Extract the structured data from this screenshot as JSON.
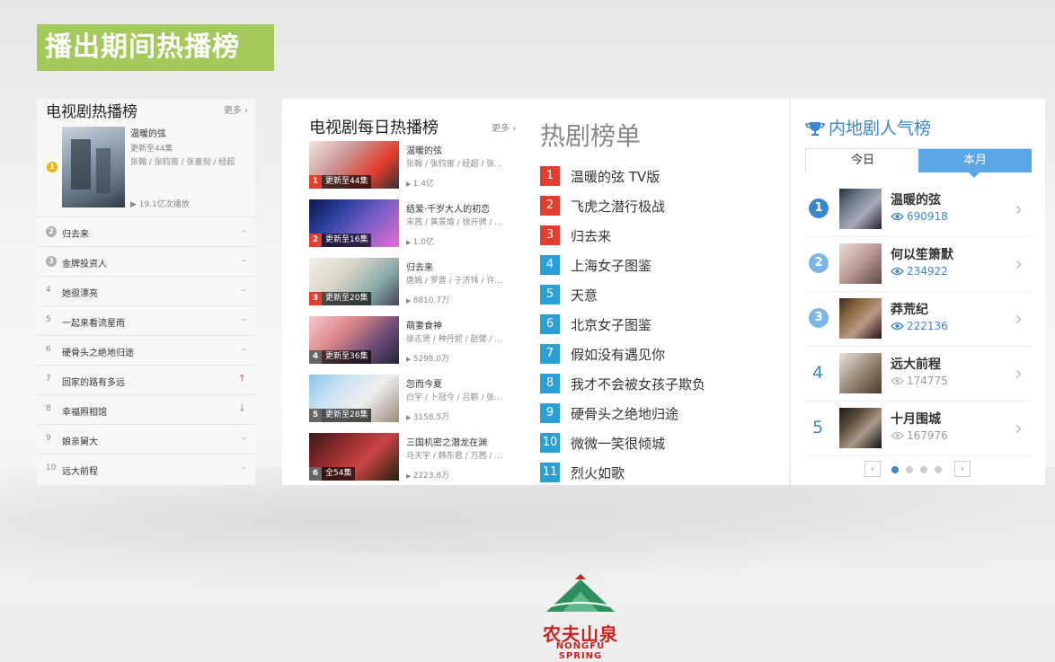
{
  "banner": {
    "title": "播出期间热播榜"
  },
  "tv_hot": {
    "heading": "电视剧热播榜",
    "more": "更多",
    "featured": {
      "rank": "1",
      "title": "温暖的弦",
      "update": "更新至44集",
      "cast": "张翰 / 张钧甯 / 张嘉倪 / 经超",
      "views": "19.1亿次播放"
    },
    "rows": [
      {
        "rank": "2",
        "name": "归去来",
        "trend": "–"
      },
      {
        "rank": "3",
        "name": "金牌投资人",
        "trend": "–"
      },
      {
        "rank": "4",
        "name": "她很漂亮",
        "trend": "–"
      },
      {
        "rank": "5",
        "name": "一起来看流星雨",
        "trend": "–"
      },
      {
        "rank": "6",
        "name": "硬骨头之绝地归途",
        "trend": "–"
      },
      {
        "rank": "7",
        "name": "回家的路有多远",
        "trend": "↑"
      },
      {
        "rank": "8",
        "name": "幸福照相馆",
        "trend": "↓"
      },
      {
        "rank": "9",
        "name": "娘亲舅大",
        "trend": "–"
      },
      {
        "rank": "10",
        "name": "远大前程",
        "trend": "–"
      }
    ]
  },
  "daily": {
    "heading": "电视剧每日热播榜",
    "more": "更多",
    "items": [
      {
        "rank": "1",
        "tag": "更新至44集",
        "title": "温暖的弦",
        "cast": "张翰 / 张钧甯 / 经超 / 张...",
        "views": "1.4亿"
      },
      {
        "rank": "2",
        "tag": "更新至16集",
        "title": "结爱·千岁大人的初恋",
        "cast": "宋茜 / 黄景瑜 / 徐开骋 / ...",
        "views": "1.0亿"
      },
      {
        "rank": "3",
        "tag": "更新至20集",
        "title": "归去来",
        "cast": "唐嫣 / 罗晋 / 于济玮 / 许...",
        "views": "8810.7万"
      },
      {
        "rank": "4",
        "tag": "更新至36集",
        "title": "萌妻食神",
        "cast": "徐志贤 / 种丹妮 / 赵健 / ...",
        "views": "5298.0万"
      },
      {
        "rank": "5",
        "tag": "更新至28集",
        "title": "忽而今夏",
        "cast": "白宇 / 卜冠今 / 吕鹏 / 张...",
        "views": "3158.5万"
      },
      {
        "rank": "6",
        "tag": "全54集",
        "title": "三国机密之潜龙在渊",
        "cast": "马天宇 / 韩东君 / 万茜 / ...",
        "views": "2223.8万"
      }
    ]
  },
  "hot_list": {
    "heading": "热剧榜单",
    "items": [
      {
        "rank": "1",
        "name": "温暖的弦 TV版"
      },
      {
        "rank": "2",
        "name": "飞虎之潜行极战"
      },
      {
        "rank": "3",
        "name": "归去来"
      },
      {
        "rank": "4",
        "name": "上海女子图鉴"
      },
      {
        "rank": "5",
        "name": "天意"
      },
      {
        "rank": "6",
        "name": "北京女子图鉴"
      },
      {
        "rank": "7",
        "name": "假如没有遇见你"
      },
      {
        "rank": "8",
        "name": "我才不会被女孩子欺负"
      },
      {
        "rank": "9",
        "name": "硬骨头之绝地归途"
      },
      {
        "rank": "10",
        "name": "微微一笑很倾城"
      },
      {
        "rank": "11",
        "name": "烈火如歌"
      }
    ]
  },
  "popular": {
    "heading": "内地剧人气榜",
    "tabs": [
      "今日",
      "本月"
    ],
    "active_tab": "本月",
    "items": [
      {
        "rank": "1",
        "name": "温暖的弦",
        "count": "690918"
      },
      {
        "rank": "2",
        "name": "何以笙箫默",
        "count": "234922"
      },
      {
        "rank": "3",
        "name": "莽荒纪",
        "count": "222136"
      },
      {
        "rank": "4",
        "name": "远大前程",
        "count": "174775"
      },
      {
        "rank": "5",
        "name": "十月围城",
        "count": "167976"
      }
    ],
    "pager": {
      "prev": "‹",
      "next": "›",
      "pages": 4,
      "current": 1
    }
  },
  "brand": {
    "name": "农夫山泉",
    "sub": "NONGFU SPRING"
  },
  "colors": {
    "banner": "#a3c95a",
    "accent_blue": "#3a87d0",
    "rank_red": "#e23d2d",
    "rank_blue": "#2a9fd6",
    "brand_red": "#c8231f"
  }
}
